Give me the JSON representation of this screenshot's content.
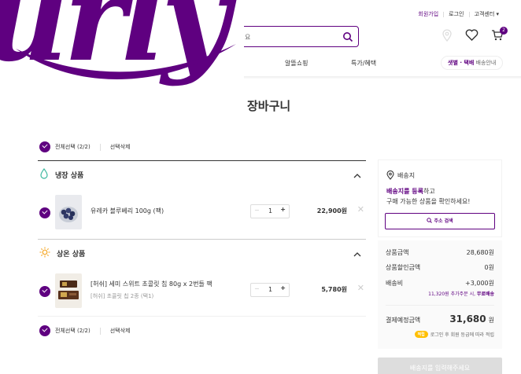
{
  "header": {
    "util_links": [
      "회원가입",
      "로그인",
      "고객센터 ▾"
    ],
    "search_placeholder": "요",
    "menu": [
      "알뜰쇼핑",
      "특가/혜택"
    ],
    "delivery_pill": {
      "highlight": "샛별 · 택배",
      "text": " 배송안내"
    },
    "cart_count": "2",
    "logo_text": "urly"
  },
  "page_title": "장바구니",
  "selection": {
    "top": {
      "label": "전체선택 (2/2)",
      "delete": "선택삭제"
    },
    "bottom": {
      "label": "전체선택 (2/2)",
      "delete": "선택삭제"
    }
  },
  "sections": [
    {
      "title": "냉장 상품",
      "items": [
        {
          "name": "유레카 블루베리 100g (팩)",
          "qty": "1",
          "price": "22,900원",
          "minus": "−",
          "plus": "+",
          "delete": "✕"
        }
      ]
    },
    {
      "title": "상온 상품",
      "items": [
        {
          "name": "[허쉬] 세미 스위트 초콜릿 칩 80g x 2번들 팩",
          "sub": "[허쉬] 초콜릿 칩 2종 (택1)",
          "qty": "1",
          "price": "5,780원",
          "minus": "−",
          "plus": "+",
          "delete": "✕"
        }
      ]
    }
  ],
  "address": {
    "title": "배송지",
    "msg_highlight": "배송지를 등록",
    "msg_rest": "하고",
    "msg_line2": "구매 가능한 상품을 확인하세요!",
    "button": "주소 검색"
  },
  "summary": {
    "product_label": "상품금액",
    "product_value": "28,680원",
    "discount_label": "상품할인금액",
    "discount_value": "0원",
    "shipping_label": "배송비",
    "shipping_value": "+3,000원",
    "note_pre": "11,320원 추가주문 시, ",
    "note_bold": "무료배송",
    "total_label": "결제예정금액",
    "total_value": "31,680",
    "total_unit": "원",
    "point_badge": "적립",
    "point_text": "로그인 후 회원 등급에 따라 적립"
  },
  "cta": "배송지를 입력해주세요"
}
